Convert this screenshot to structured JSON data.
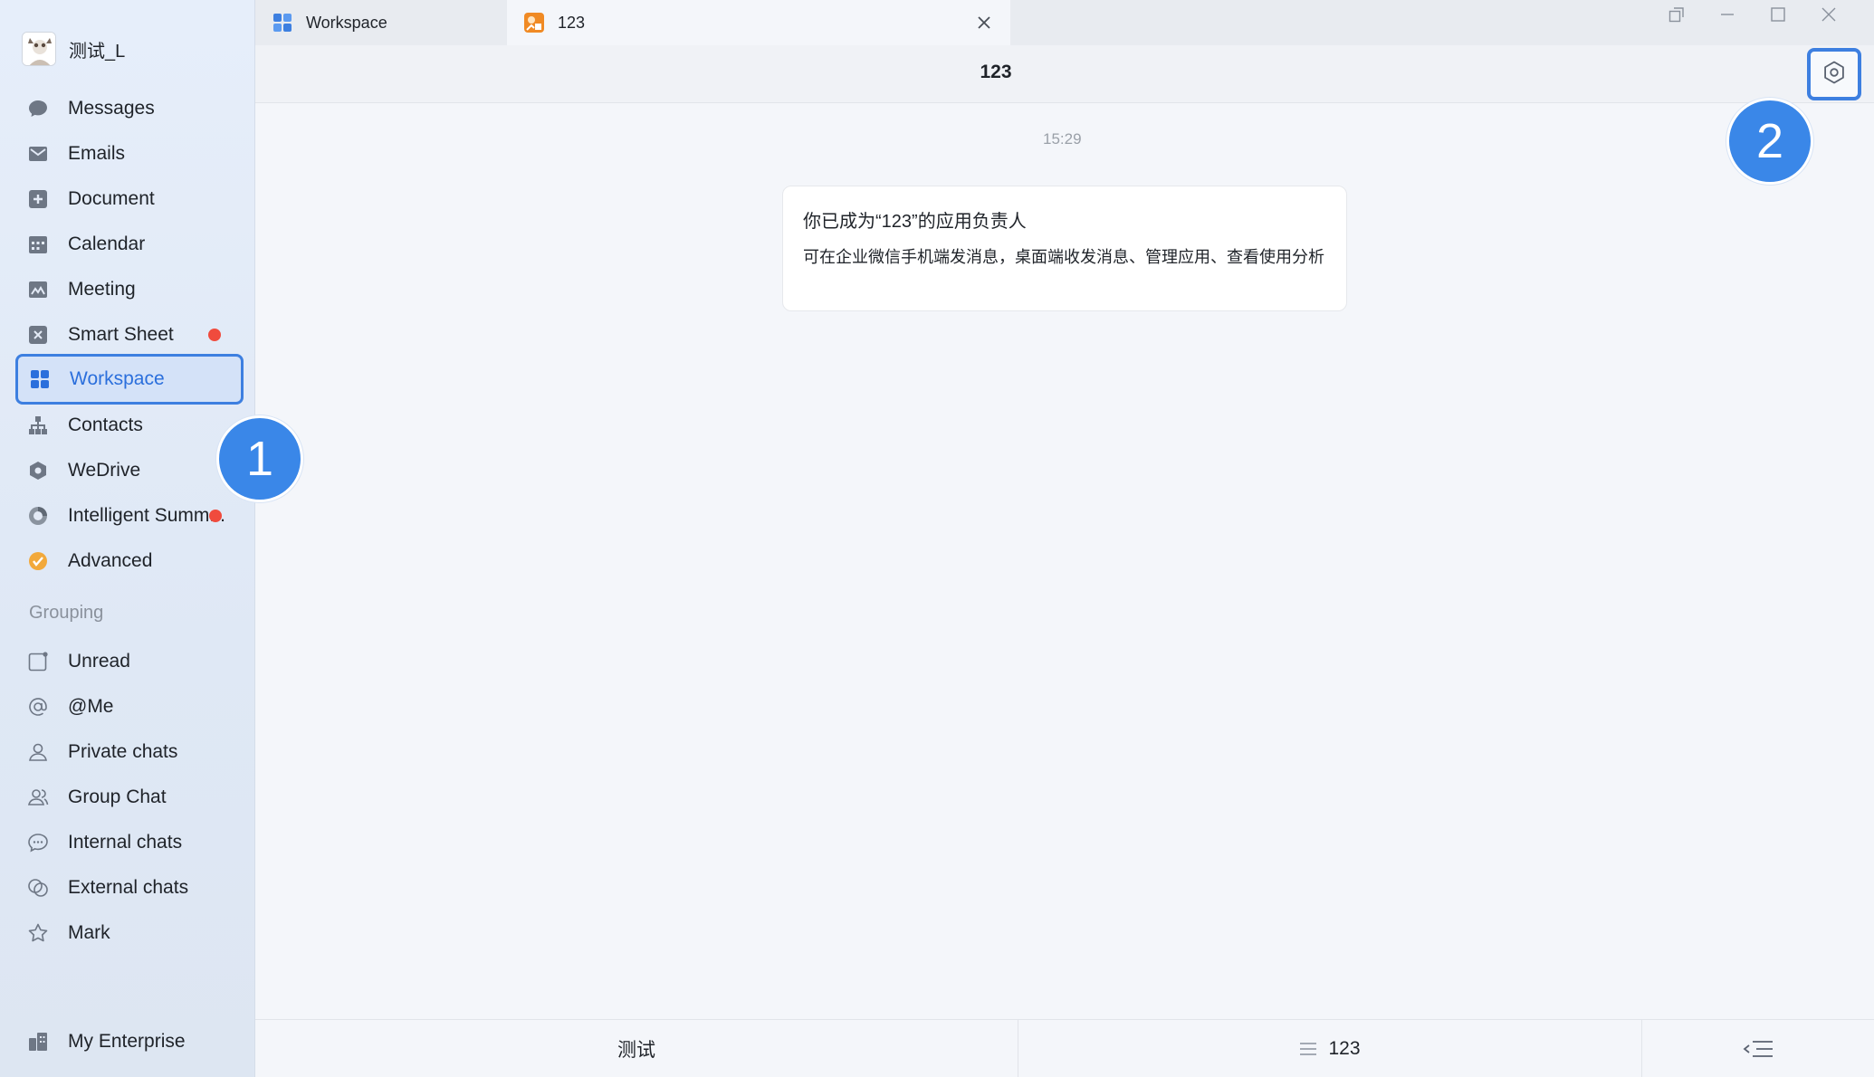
{
  "profile": {
    "name": "测试_L"
  },
  "sidebar": {
    "items": [
      {
        "label": "Messages",
        "icon": "chat-bubble-icon"
      },
      {
        "label": "Emails",
        "icon": "mail-icon"
      },
      {
        "label": "Document",
        "icon": "document-icon"
      },
      {
        "label": "Calendar",
        "icon": "calendar-icon"
      },
      {
        "label": "Meeting",
        "icon": "meeting-icon"
      },
      {
        "label": "Smart Sheet",
        "icon": "smart-sheet-icon",
        "badge": true
      },
      {
        "label": "Workspace",
        "icon": "workspace-grid-icon",
        "active": true
      },
      {
        "label": "Contacts",
        "icon": "org-chart-icon"
      },
      {
        "label": "WeDrive",
        "icon": "wedrive-icon"
      },
      {
        "label": "Intelligent Summ...",
        "icon": "intelligent-summary-icon",
        "badge": true
      },
      {
        "label": "Advanced",
        "icon": "advanced-icon"
      }
    ],
    "grouping_title": "Grouping",
    "groups": [
      {
        "label": "Unread",
        "icon": "unread-icon"
      },
      {
        "label": "@Me",
        "icon": "at-icon"
      },
      {
        "label": "Private chats",
        "icon": "person-icon"
      },
      {
        "label": "Group Chat",
        "icon": "group-icon"
      },
      {
        "label": "Internal chats",
        "icon": "internal-chat-icon"
      },
      {
        "label": "External chats",
        "icon": "external-chat-icon"
      },
      {
        "label": "Mark",
        "icon": "star-icon"
      }
    ],
    "footer": {
      "label": "My Enterprise",
      "icon": "enterprise-icon"
    }
  },
  "tabs": [
    {
      "label": "Workspace",
      "icon": "workspace-grid-icon",
      "active": false
    },
    {
      "label": "123",
      "icon": "app-icon",
      "active": true
    }
  ],
  "chat": {
    "title": "123",
    "timestamp": "15:29",
    "card": {
      "title": "你已成为“123”的应用负责人",
      "body": "可在企业微信手机端发消息，桌面端收发消息、管理应用、查看使用分析"
    }
  },
  "bottom_bar": {
    "left_label": "测试",
    "middle_label": "123"
  },
  "annotations": [
    "1",
    "2"
  ],
  "colors": {
    "accent": "#3d7fe0",
    "badge": "#3a87e8",
    "red_dot": "#f04b3d"
  }
}
